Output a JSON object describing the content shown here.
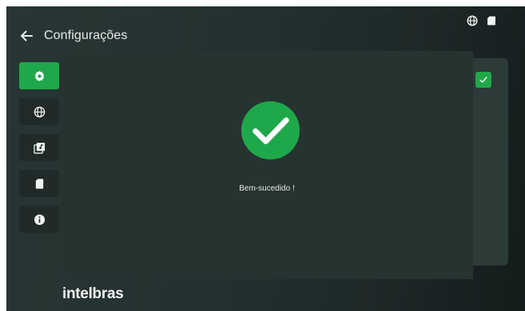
{
  "header": {
    "title": "Configurações",
    "back_icon": "arrow-left-icon",
    "status_icons": [
      "globe-icon",
      "sd-card-icon"
    ]
  },
  "sidebar": {
    "items": [
      {
        "icon": "gear-icon",
        "active": true
      },
      {
        "icon": "globe-icon",
        "active": false
      },
      {
        "icon": "media-library-icon",
        "active": false
      },
      {
        "icon": "sd-card-icon",
        "active": false
      },
      {
        "icon": "info-icon",
        "active": false
      }
    ]
  },
  "dialog": {
    "icon": "check-circle-icon",
    "message": "Bem-sucedido !"
  },
  "brand": {
    "logo": "intelbras"
  },
  "colors": {
    "accent": "#1fa84a",
    "background": "#23302f",
    "dialog": "#263331",
    "text": "#e7ecea"
  }
}
